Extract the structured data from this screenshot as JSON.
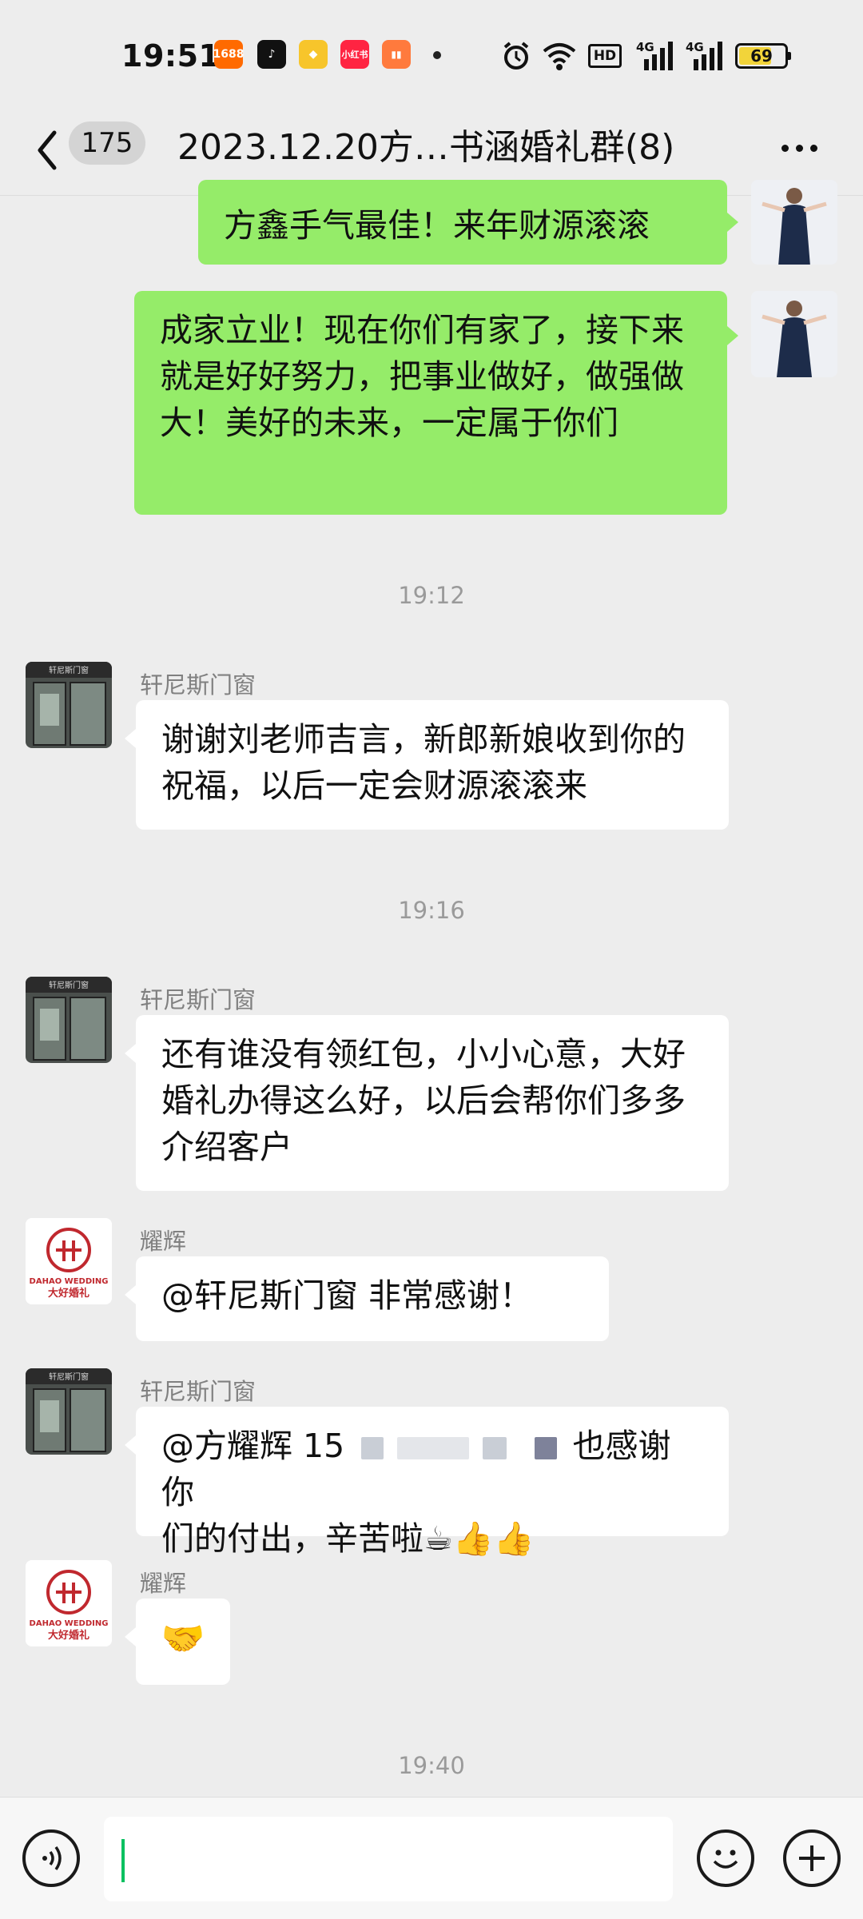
{
  "status_bar": {
    "time": "19:51",
    "apps": [
      {
        "name": "alibaba-1688-icon",
        "label": "1688",
        "color": "#ff6a00"
      },
      {
        "name": "tiktok-icon",
        "label": "♪",
        "color": "#111111"
      },
      {
        "name": "yellow-app-icon",
        "label": "◆",
        "color": "#f7c52b"
      },
      {
        "name": "xiaohongshu-icon",
        "label": "小红书",
        "color": "#ff2442"
      },
      {
        "name": "book-app-icon",
        "label": "▮▮",
        "color": "#ff7a3d"
      }
    ],
    "network_hd": "HD",
    "network_1": "4G",
    "network_2": "4G",
    "battery": "69"
  },
  "header": {
    "unread_count": "175",
    "title": "2023.12.20方…书涵婚礼群(8)"
  },
  "messages": [
    {
      "text": "方鑫手气最佳！来年财源滚滚"
    },
    {
      "text": "成家立业！现在你们有家了，接下来就是好好努力，把事业做好，做强做大！美好的未来，一定属于你们"
    },
    {
      "timestamp": "19:12"
    },
    {
      "sender": "轩尼斯门窗",
      "text": "谢谢刘老师吉言，新郎新娘收到你的祝福，以后一定会财源滚滚来"
    },
    {
      "timestamp": "19:16"
    },
    {
      "sender": "轩尼斯门窗",
      "text": "还有谁没有领红包，小小心意，大好婚礼办得这么好，以后会帮你们多多介绍客户"
    },
    {
      "sender": "耀辉",
      "text": "@轩尼斯门窗  非常感谢！"
    },
    {
      "sender": "轩尼斯门窗",
      "text_prefix": "@方耀辉 15",
      "text_suffix_1": "也感谢你",
      "text_suffix_2": "们的付出，辛苦啦☕👍👍"
    },
    {
      "sender": "耀辉",
      "text": "🤝"
    },
    {
      "timestamp": "19:40"
    }
  ],
  "avatars": {
    "door_store_sign": "轩尼斯门窗",
    "wedding_logo_en": "DAHAO WEDDING",
    "wedding_logo_cn": "大好婚礼"
  }
}
